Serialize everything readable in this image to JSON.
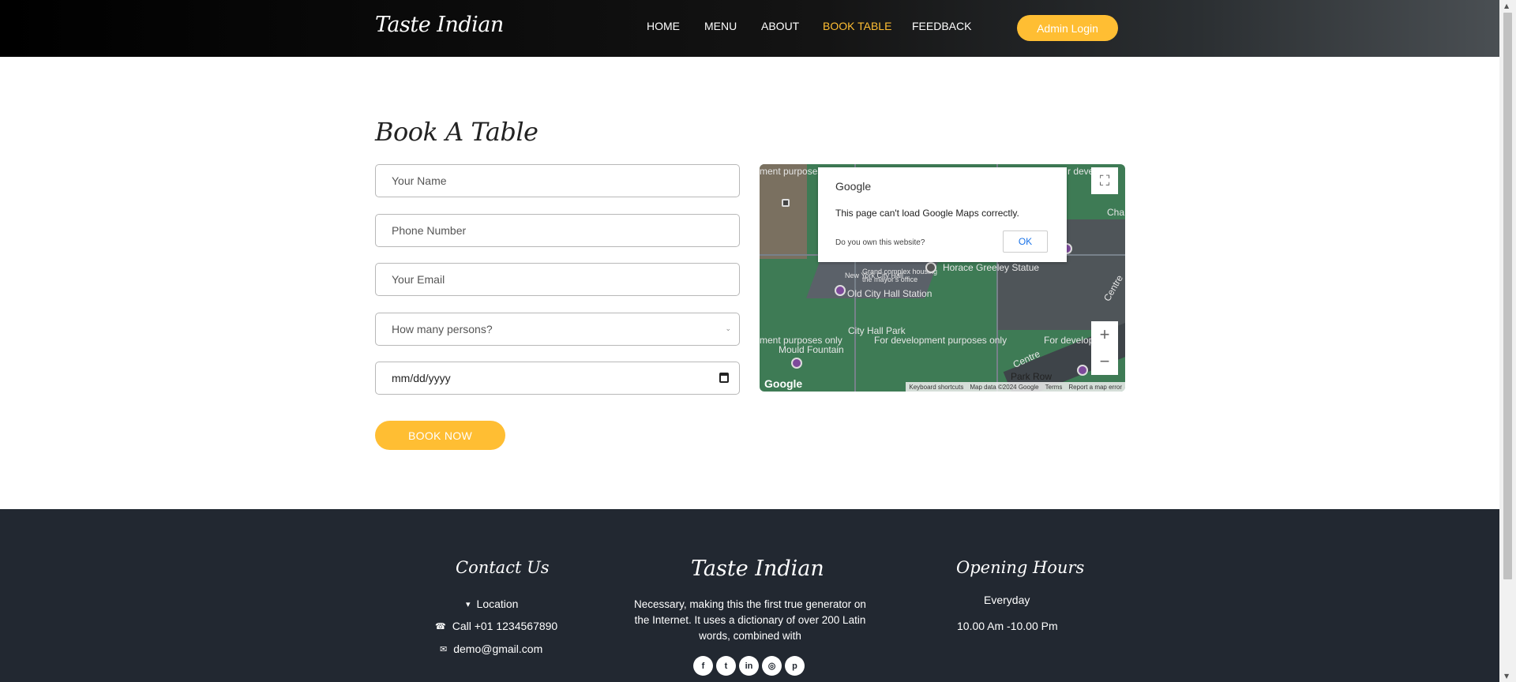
{
  "header": {
    "brand": "Taste Indian",
    "nav": [
      "HOME",
      "MENU",
      "ABOUT",
      "BOOK TABLE",
      "FEEDBACK"
    ],
    "active_nav": "BOOK TABLE",
    "admin_button": "Admin Login"
  },
  "booking": {
    "title": "Book A Table",
    "name_placeholder": "Your Name",
    "phone_placeholder": "Phone Number",
    "email_placeholder": "Your Email",
    "persons_select": "How many persons?",
    "date_placeholder": "mm/dd/yyyy",
    "submit_label": "BOOK NOW"
  },
  "map": {
    "dialog_brand": "Google",
    "dialog_message": "This page can't load Google Maps correctly.",
    "dialog_question": "Do you own this website?",
    "dialog_ok": "OK",
    "labels": {
      "dev1": "ment purposes only",
      "dev2": "For development purposes only",
      "dev3": "For develop",
      "old_city_hall": "Old City Hall Station",
      "city_hall_park": "City Hall Park",
      "mould_fountain": "Mould Fountain",
      "horace": "Horace Greeley Statue",
      "new_york_city_hall": "New York City Hall",
      "grand_complex": "Grand complex housing",
      "mayors_office": "the mayor's office",
      "centre": "Centre",
      "park_row": "Park Row",
      "cha": "Cha",
      "top_left": "ment purposes o",
      "top_right": "r develop",
      "google_logo": "Google"
    },
    "attribution": [
      "Keyboard shortcuts",
      "Map data ©2024 Google",
      "Terms",
      "Report a map error"
    ],
    "zoom_in": "+",
    "zoom_out": "−"
  },
  "footer": {
    "contact": {
      "title": "Contact Us",
      "location": "Location",
      "phone": "Call +01 1234567890",
      "email": "demo@gmail.com"
    },
    "about": {
      "title": "Taste Indian",
      "text": "Necessary, making this the first true generator on the Internet. It uses a dictionary of over 200 Latin words, combined with"
    },
    "hours": {
      "title": "Opening Hours",
      "days": "Everyday",
      "time": "10.00 Am -10.00 Pm"
    },
    "social": [
      "facebook-icon",
      "twitter-icon",
      "linkedin-icon",
      "instagram-icon",
      "pinterest-icon"
    ]
  },
  "colors": {
    "accent": "#ffbe33",
    "footer_bg": "#222831",
    "header_bg": "#000000"
  }
}
